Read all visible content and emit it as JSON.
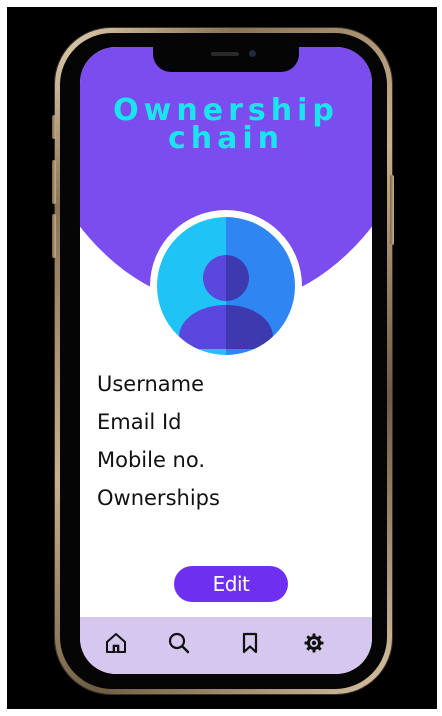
{
  "app": {
    "title_line1": "Ownership",
    "title_line2": "chain"
  },
  "profile": {
    "avatar_icon": "user-avatar-icon",
    "fields": [
      {
        "label": "Username"
      },
      {
        "label": "Email Id"
      },
      {
        "label": "Mobile no."
      },
      {
        "label": "Ownerships"
      }
    ]
  },
  "actions": {
    "edit_label": "Edit"
  },
  "bottom_nav": {
    "items": [
      {
        "icon": "home-icon"
      },
      {
        "icon": "search-icon"
      },
      {
        "icon": "bookmark-icon"
      },
      {
        "icon": "settings-icon"
      }
    ]
  },
  "colors": {
    "header_purple": "#7c4dee",
    "title_cyan": "#1ae5ee",
    "edit_button": "#6f2ff0",
    "nav_background": "#d6c7ef",
    "avatar_light_blue": "#1fc3f5",
    "avatar_dark_blue": "#2f86f2",
    "avatar_figure": "#5a47de"
  }
}
